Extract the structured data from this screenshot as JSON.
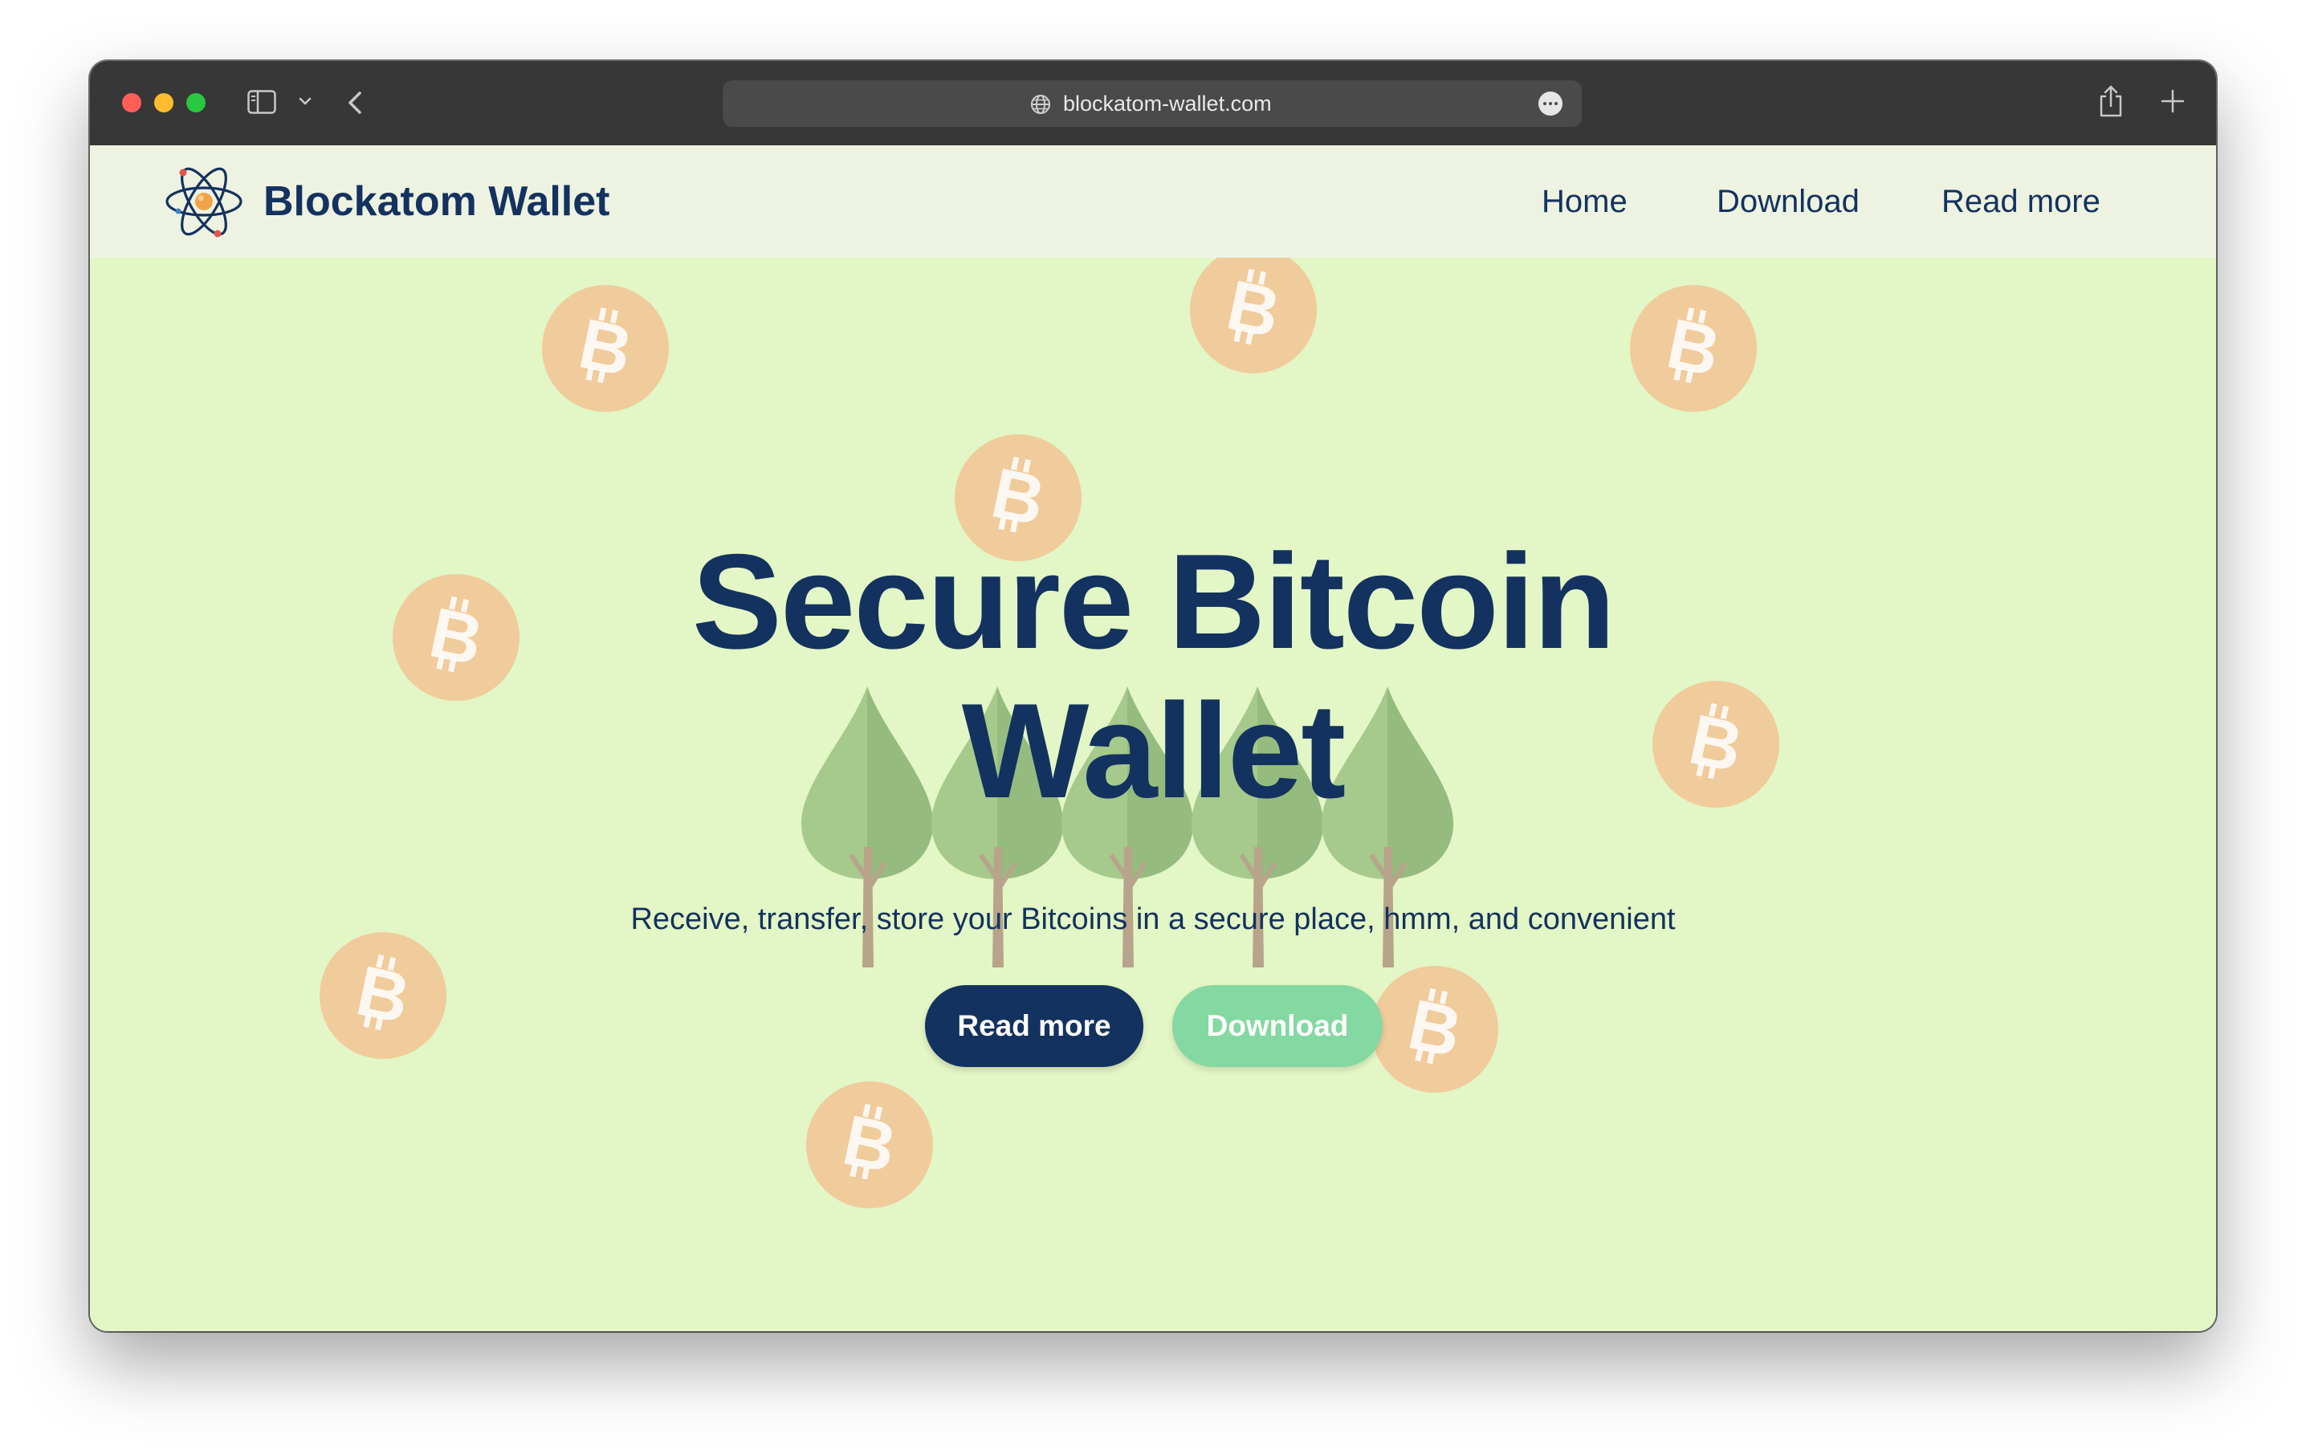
{
  "browser": {
    "url": "blockatom-wallet.com",
    "icons": [
      "sidebar-icon",
      "chevron-down-icon",
      "back-arrow-icon",
      "globe-icon",
      "more-icon",
      "share-icon",
      "plus-icon"
    ]
  },
  "header": {
    "brand": "Blockatom Wallet",
    "logo_icon": "atom-icon",
    "nav": {
      "home": "Home",
      "download": "Download",
      "read_more": "Read more"
    }
  },
  "hero": {
    "title_line1": "Secure Bitcoin",
    "title_line2": "Wallet",
    "subtitle": "Receive, transfer, store your Bitcoins in a secure place, hmm, and convenient",
    "read_more_button": "Read more",
    "download_button": "Download",
    "coin_icon": "bitcoin-icon"
  },
  "colors": {
    "brand_navy": "#13325f",
    "hero_background": "#e3f6c5",
    "header_background": "#eef3e1",
    "download_green": "#84d8a1",
    "coin_orange": "#f0cb9b",
    "titlebar": "#373737"
  }
}
